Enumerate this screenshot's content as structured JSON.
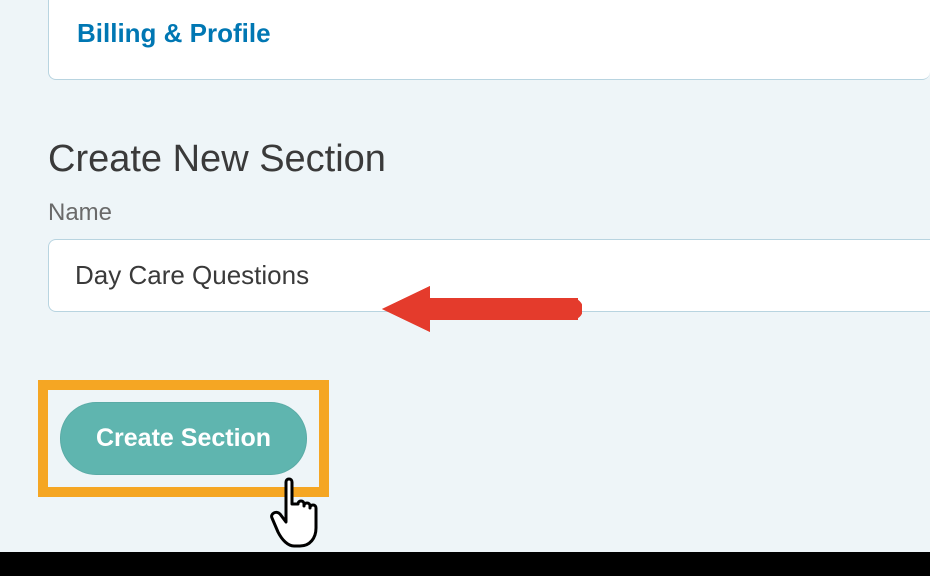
{
  "topPanel": {
    "linkLabel": "Billing & Profile"
  },
  "createSection": {
    "heading": "Create New Section",
    "nameLabel": "Name",
    "nameValue": "Day Care Questions",
    "buttonLabel": "Create Section"
  }
}
